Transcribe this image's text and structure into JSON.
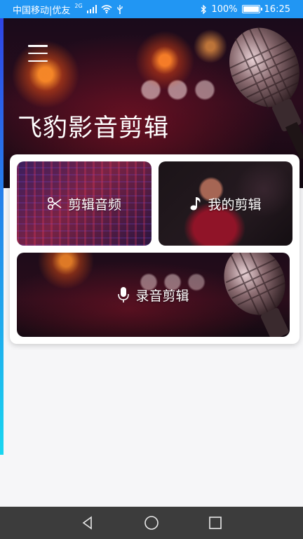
{
  "status_bar": {
    "carrier": "中国移动|优友",
    "network": "2G",
    "battery_text": "100%",
    "battery_level": 1.0,
    "time": "16:25",
    "icons": [
      "signal-icon",
      "wifi-icon",
      "usb-icon",
      "bluetooth-icon",
      "battery-icon"
    ]
  },
  "hero": {
    "title": "飞豹影音剪辑",
    "menu_icon": "hamburger-menu-icon"
  },
  "tiles": {
    "edit_audio": {
      "label": "剪辑音频",
      "icon": "scissors-icon"
    },
    "my_edits": {
      "label": "我的剪辑",
      "icon": "music-note-icon"
    },
    "record_edit": {
      "label": "录音剪辑",
      "icon": "microphone-icon"
    }
  },
  "nav_bar": {
    "back": "back-triangle-icon",
    "home": "home-circle-icon",
    "recents": "recents-square-icon"
  },
  "colors": {
    "status_bar": "#2196f3",
    "accent_top": "#2f45e6",
    "accent_bottom": "#19d6f0",
    "nav_bar": "#3c3c3c",
    "page_bg": "#f6f6f8"
  }
}
